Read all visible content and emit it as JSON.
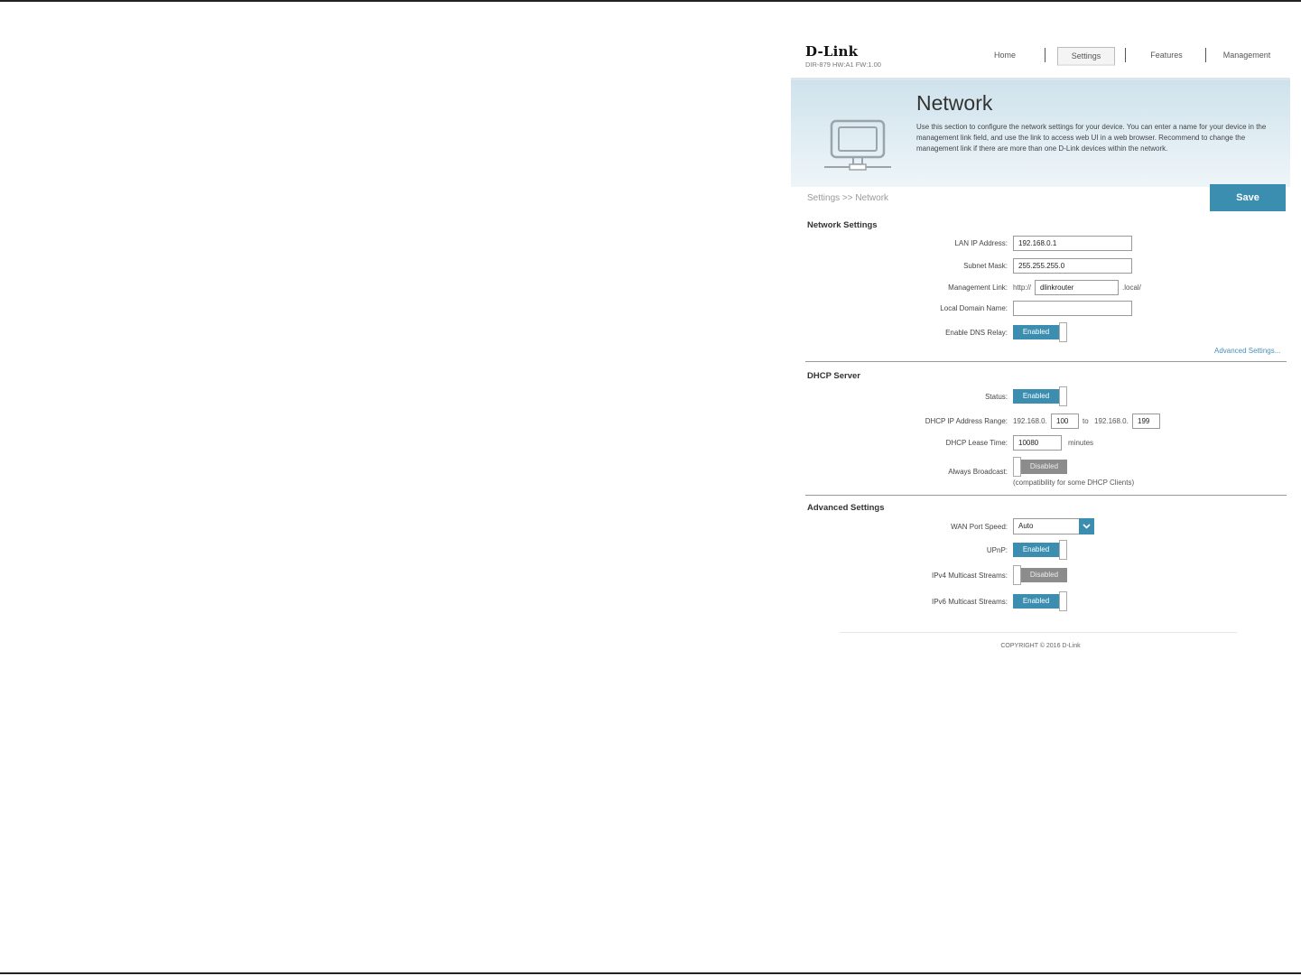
{
  "header": {
    "brand": "D-Link",
    "model": "DIR-879 HW:A1 FW:1.00",
    "nav": [
      {
        "label": "Home",
        "active": false
      },
      {
        "label": "Settings",
        "active": true
      },
      {
        "label": "Features",
        "active": false
      },
      {
        "label": "Management",
        "active": false
      }
    ]
  },
  "banner": {
    "title": "Network",
    "description": "Use this section to configure the network settings for your device. You can enter a name for your device in the management link field, and use the link to access web UI in a web browser. Recommend to change the management link if there are more than one D-Link devices within the network.",
    "icon": "monitor-network-icon"
  },
  "breadcrumb": "Settings >> Network",
  "save_label": "Save",
  "network_settings": {
    "title": "Network Settings",
    "lan_ip_label": "LAN IP Address:",
    "lan_ip_value": "192.168.0.1",
    "subnet_label": "Subnet Mask:",
    "subnet_value": "255.255.255.0",
    "mgmt_label": "Management Link:",
    "mgmt_prefix": "http://",
    "mgmt_value": "dlinkrouter",
    "mgmt_suffix": ".local/",
    "domain_label": "Local Domain Name:",
    "domain_value": "",
    "dns_relay_label": "Enable DNS Relay:",
    "dns_relay_state": "Enabled",
    "advanced_link": "Advanced Settings..."
  },
  "dhcp_server": {
    "title": "DHCP Server",
    "status_label": "Status:",
    "status_state": "Enabled",
    "range_label": "DHCP IP Address Range:",
    "range_prefix_start": "192.168.0.",
    "range_start": "100",
    "range_to": "to",
    "range_prefix_end": "192.168.0.",
    "range_end": "199",
    "lease_label": "DHCP Lease Time:",
    "lease_value": "10080",
    "lease_unit": "minutes",
    "broadcast_label": "Always Broadcast:",
    "broadcast_state": "Disabled",
    "broadcast_note": "(compatibility for some DHCP Clients)"
  },
  "advanced_settings": {
    "title": "Advanced Settings",
    "wan_speed_label": "WAN Port Speed:",
    "wan_speed_value": "Auto",
    "upnp_label": "UPnP:",
    "upnp_state": "Enabled",
    "ipv4_multicast_label": "IPv4 Multicast Streams:",
    "ipv4_multicast_state": "Disabled",
    "ipv6_multicast_label": "IPv6 Multicast Streams:",
    "ipv6_multicast_state": "Enabled"
  },
  "footer": "COPYRIGHT © 2016 D-Link",
  "colors": {
    "accent": "#3b8eb0",
    "disabled": "#8c8c8c",
    "link": "#4a90b8"
  }
}
